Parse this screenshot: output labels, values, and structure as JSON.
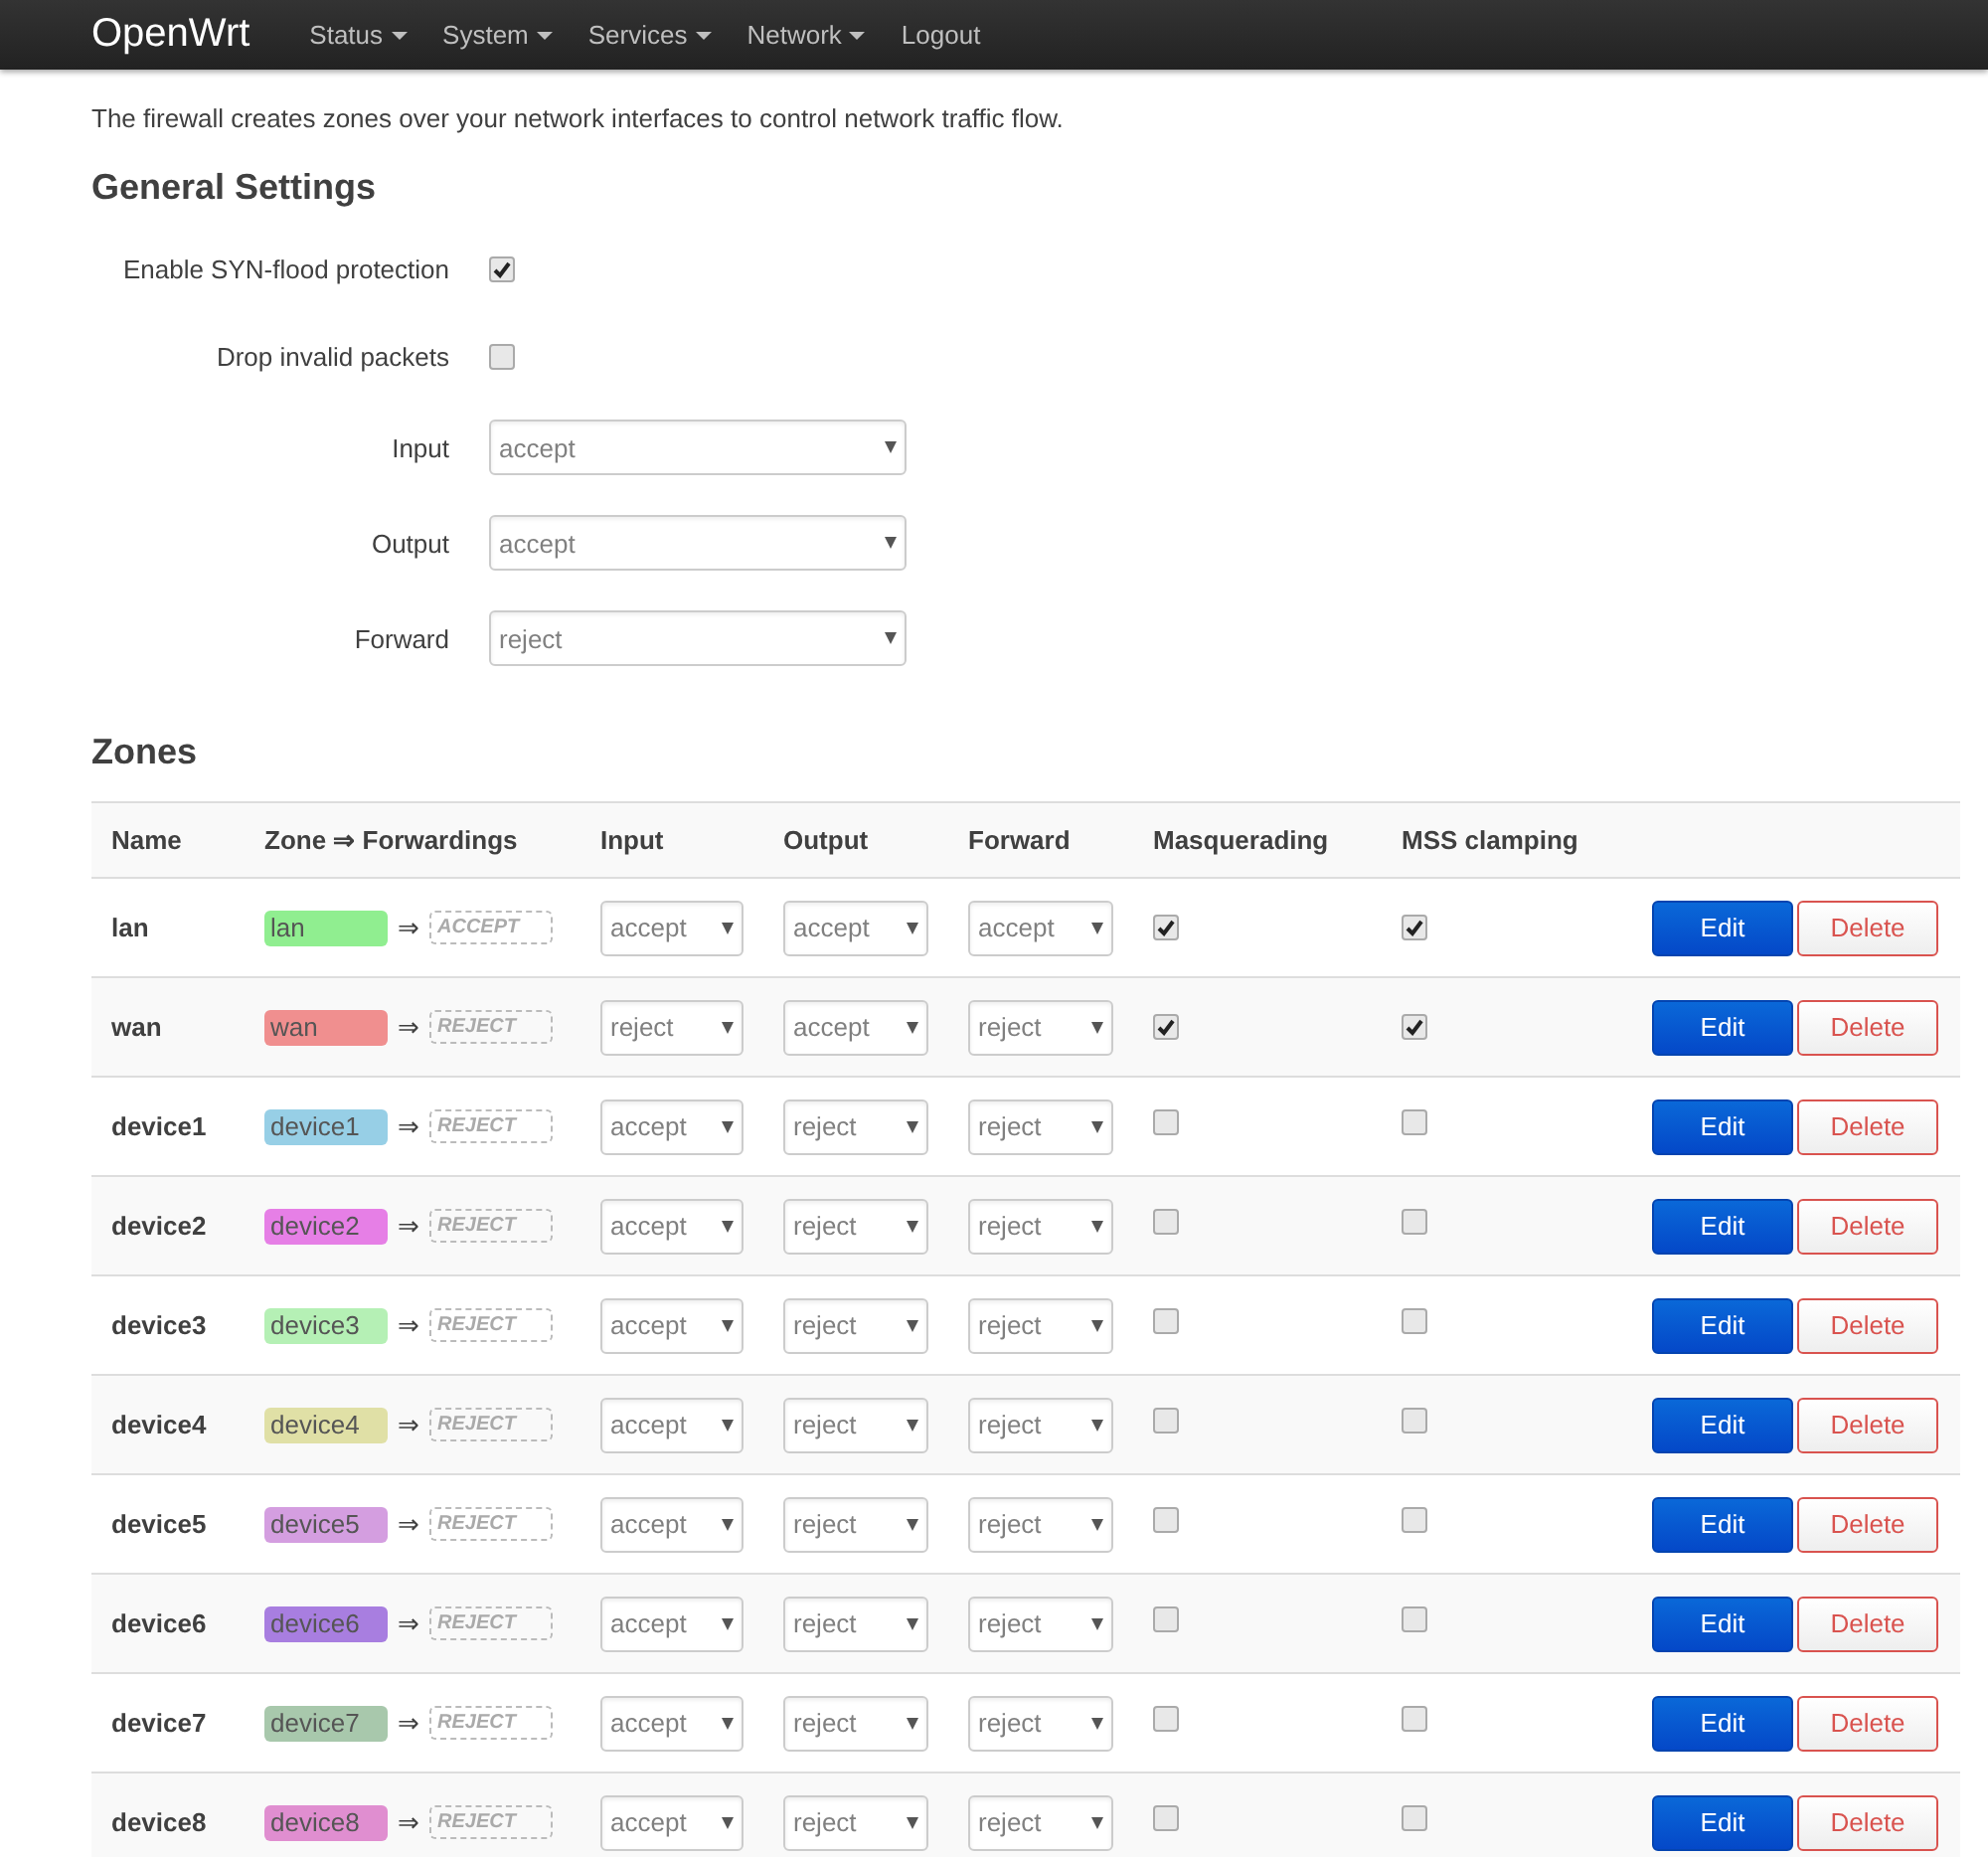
{
  "navbar": {
    "brand": "OpenWrt",
    "menu": [
      {
        "label": "Status",
        "dropdown": true
      },
      {
        "label": "System",
        "dropdown": true
      },
      {
        "label": "Services",
        "dropdown": true
      },
      {
        "label": "Network",
        "dropdown": true
      },
      {
        "label": "Logout",
        "dropdown": false
      }
    ]
  },
  "page": {
    "description": "The firewall creates zones over your network interfaces to control network traffic flow."
  },
  "general_settings": {
    "heading": "General Settings",
    "fields": [
      {
        "kind": "checkbox",
        "label": "Enable SYN-flood protection",
        "checked": true
      },
      {
        "kind": "checkbox",
        "label": "Drop invalid packets",
        "checked": false
      },
      {
        "kind": "select",
        "label": "Input",
        "value": "accept"
      },
      {
        "kind": "select",
        "label": "Output",
        "value": "accept"
      },
      {
        "kind": "select",
        "label": "Forward",
        "value": "reject"
      }
    ]
  },
  "zones": {
    "heading": "Zones",
    "columns": [
      "Name",
      "Zone ⇒ Forwardings",
      "Input",
      "Output",
      "Forward",
      "Masquerading",
      "MSS clamping"
    ],
    "rows": [
      {
        "name": "lan",
        "zone": "lan",
        "color": "#90ee90",
        "arrow": "⇒",
        "forwarding": "ACCEPT",
        "input": "accept",
        "output": "accept",
        "forward": "accept",
        "masquerading": true,
        "mss_clamping": true
      },
      {
        "name": "wan",
        "zone": "wan",
        "color": "#f08f8f",
        "arrow": "⇒",
        "forwarding": "REJECT",
        "input": "reject",
        "output": "accept",
        "forward": "reject",
        "masquerading": true,
        "mss_clamping": true
      },
      {
        "name": "device1",
        "zone": "device1",
        "color": "#97cfe6",
        "arrow": "⇒",
        "forwarding": "REJECT",
        "input": "accept",
        "output": "reject",
        "forward": "reject",
        "masquerading": false,
        "mss_clamping": false
      },
      {
        "name": "device2",
        "zone": "device2",
        "color": "#e67fe6",
        "arrow": "⇒",
        "forwarding": "REJECT",
        "input": "accept",
        "output": "reject",
        "forward": "reject",
        "masquerading": false,
        "mss_clamping": false
      },
      {
        "name": "device3",
        "zone": "device3",
        "color": "#b5f0b5",
        "arrow": "⇒",
        "forwarding": "REJECT",
        "input": "accept",
        "output": "reject",
        "forward": "reject",
        "masquerading": false,
        "mss_clamping": false
      },
      {
        "name": "device4",
        "zone": "device4",
        "color": "#e0e0a6",
        "arrow": "⇒",
        "forwarding": "REJECT",
        "input": "accept",
        "output": "reject",
        "forward": "reject",
        "masquerading": false,
        "mss_clamping": false
      },
      {
        "name": "device5",
        "zone": "device5",
        "color": "#d49ee0",
        "arrow": "⇒",
        "forwarding": "REJECT",
        "input": "accept",
        "output": "reject",
        "forward": "reject",
        "masquerading": false,
        "mss_clamping": false
      },
      {
        "name": "device6",
        "zone": "device6",
        "color": "#a87ee0",
        "arrow": "⇒",
        "forwarding": "REJECT",
        "input": "accept",
        "output": "reject",
        "forward": "reject",
        "masquerading": false,
        "mss_clamping": false
      },
      {
        "name": "device7",
        "zone": "device7",
        "color": "#a8c8ac",
        "arrow": "⇒",
        "forwarding": "REJECT",
        "input": "accept",
        "output": "reject",
        "forward": "reject",
        "masquerading": false,
        "mss_clamping": false
      },
      {
        "name": "device8",
        "zone": "device8",
        "color": "#e08ed0",
        "arrow": "⇒",
        "forwarding": "REJECT",
        "input": "accept",
        "output": "reject",
        "forward": "reject",
        "masquerading": false,
        "mss_clamping": false
      }
    ],
    "edit_labels": [
      "Edit",
      "Edit",
      "Edit",
      "Edit",
      "Edit",
      "Edit",
      "Edit",
      "Edit",
      "Edit",
      "Edit"
    ],
    "delete_labels": [
      "Delete",
      "Delete",
      "Delete",
      "Delete",
      "Delete",
      "Delete",
      "Delete",
      "Delete",
      "Delete",
      "Delete"
    ]
  }
}
